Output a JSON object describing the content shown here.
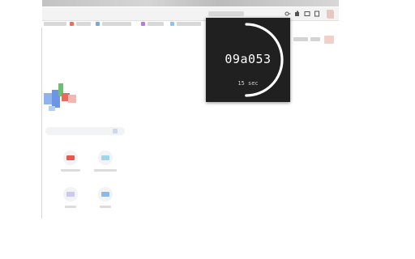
{
  "colors": {
    "popup_bg": "#202020",
    "ring": "#ffffff",
    "code_text": "#ffffff",
    "secs_text": "#cfcfcf"
  },
  "toolbar": {
    "icons": [
      "key-icon",
      "puzzle-extension-icon",
      "cast-icon",
      "tab-icon",
      "profile-icon"
    ]
  },
  "timer_popup": {
    "code": "09a053",
    "seconds_label": "15 sec",
    "progress": 0.5
  }
}
